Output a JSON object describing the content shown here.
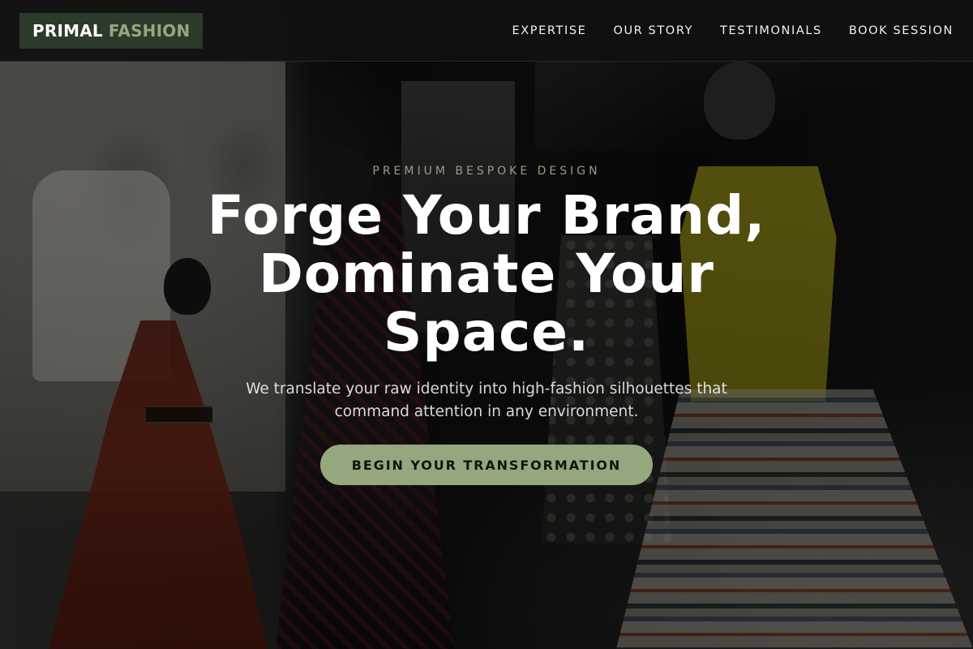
{
  "header": {
    "logo": {
      "primary": "PRIMAL",
      "accent": "FASHION"
    },
    "nav": [
      {
        "label": "EXPERTISE"
      },
      {
        "label": "OUR STORY"
      },
      {
        "label": "TESTIMONIALS"
      },
      {
        "label": "BOOK SESSION"
      }
    ]
  },
  "hero": {
    "eyebrow": "PREMIUM BESPOKE DESIGN",
    "headline": "Forge Your Brand, Dominate Your Space.",
    "subtext": "We translate your raw identity into high-fashion silhouettes that command attention in any environment.",
    "cta_label": "BEGIN YOUR TRANSFORMATION"
  },
  "theme": {
    "accent": "#95a77e",
    "logo_bg": "#2b3a2b",
    "nav_bg": "#121212"
  }
}
